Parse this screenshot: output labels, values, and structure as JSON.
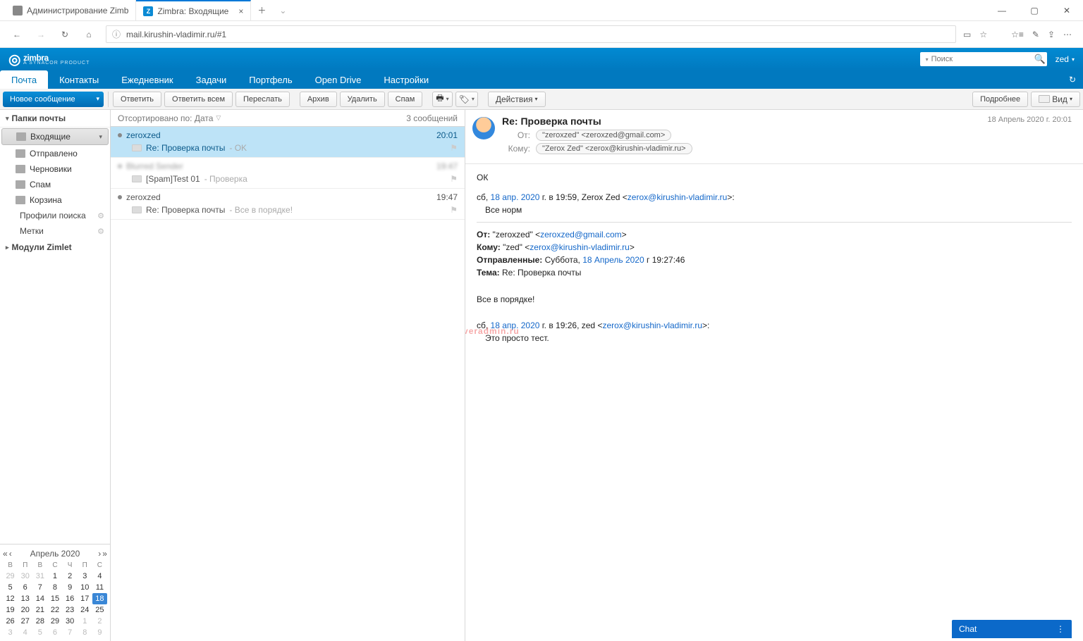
{
  "browser": {
    "tabs": [
      {
        "title": "Администрирование Zimb"
      },
      {
        "title": "Zimbra: Входящие"
      }
    ],
    "url": "mail.kirushin-vladimir.ru/#1"
  },
  "header": {
    "logo": "zimbra",
    "logo_sub": "A SYNACOR PRODUCT",
    "search_placeholder": "Поиск",
    "user": "zed"
  },
  "nav_tabs": [
    "Почта",
    "Контакты",
    "Ежедневник",
    "Задачи",
    "Портфель",
    "Open Drive",
    "Настройки"
  ],
  "toolbar": {
    "compose": "Новое сообщение",
    "reply": "Ответить",
    "reply_all": "Ответить всем",
    "forward": "Переслать",
    "archive": "Архив",
    "delete": "Удалить",
    "spam": "Спам",
    "actions": "Действия",
    "more": "Подробнее",
    "view": "Вид"
  },
  "sidebar": {
    "folders_header": "Папки почты",
    "folders": [
      {
        "label": "Входящие",
        "sel": true,
        "dd": true
      },
      {
        "label": "Отправлено"
      },
      {
        "label": "Черновики"
      },
      {
        "label": "Спам"
      },
      {
        "label": "Корзина"
      }
    ],
    "search_profiles": "Профили поиска",
    "tags": "Метки",
    "zimlets": "Модули Zimlet"
  },
  "list": {
    "sort_label": "Отсортировано по: Дата",
    "count": "3 сообщений",
    "groups": [
      {
        "from": "zeroxzed",
        "time": "20:01",
        "subject": "Re: Проверка почты",
        "preview": "OK",
        "sel": true
      },
      {
        "from": "Blurred Sender",
        "time": "19:47",
        "subject": "[Spam]Test 01",
        "preview": "Проверка",
        "blur": true
      },
      {
        "from": "zeroxzed",
        "time": "19:47",
        "subject": "Re: Проверка почты",
        "preview": "Все в порядке!"
      }
    ]
  },
  "message": {
    "subject": "Re: Проверка почты",
    "date": "18 Апрель 2020 г. 20:01",
    "from_label": "От:",
    "from_value": "\"zeroxzed\" <zeroxzed@gmail.com>",
    "to_label": "Кому:",
    "to_value": "\"Zerox Zed\" <zerox@kirushin-vladimir.ru>",
    "body_ok": "ОК",
    "line1_pre": "сб, ",
    "line1_date": "18 апр. 2020",
    "line1_post": " г. в 19:59, Zerox Zed <",
    "line1_email": "zerox@kirushin-vladimir.ru",
    "line1_end": ">:",
    "line2": "Все норм",
    "q_from_l": "От:",
    "q_from_v": " \"zeroxzed\" <",
    "q_from_e": "zeroxzed@gmail.com",
    "q_from_end": ">",
    "q_to_l": "Кому:",
    "q_to_v": " \"zed\" <",
    "q_to_e": "zerox@kirushin-vladimir.ru",
    "q_to_end": ">",
    "q_sent_l": "Отправленные:",
    "q_sent_v": " Суббота, ",
    "q_sent_d": "18 Апрель 2020",
    "q_sent_t": " г 19:27:46",
    "q_subj_l": "Тема:",
    "q_subj_v": " Re: Проверка почты",
    "q_body": "Все в порядке!",
    "q2_pre": "сб, ",
    "q2_date": "18 апр. 2020",
    "q2_mid": " г. в 19:26, zed <",
    "q2_email": "zerox@kirushin-vladimir.ru",
    "q2_end": ">:",
    "q2_body": "Это просто тест.",
    "watermark": "serveradmin.ru"
  },
  "calendar": {
    "title": "Апрель 2020",
    "dow": [
      "В",
      "П",
      "В",
      "С",
      "Ч",
      "П",
      "С"
    ],
    "weeks": [
      [
        {
          "d": 29,
          "g": true
        },
        {
          "d": 30,
          "g": true
        },
        {
          "d": 31,
          "g": true
        },
        {
          "d": 1
        },
        {
          "d": 2
        },
        {
          "d": 3
        },
        {
          "d": 4
        }
      ],
      [
        {
          "d": 5
        },
        {
          "d": 6
        },
        {
          "d": 7
        },
        {
          "d": 8
        },
        {
          "d": 9
        },
        {
          "d": 10
        },
        {
          "d": 11
        }
      ],
      [
        {
          "d": 12
        },
        {
          "d": 13
        },
        {
          "d": 14
        },
        {
          "d": 15
        },
        {
          "d": 16
        },
        {
          "d": 17
        },
        {
          "d": 18,
          "t": true
        }
      ],
      [
        {
          "d": 19
        },
        {
          "d": 20
        },
        {
          "d": 21
        },
        {
          "d": 22
        },
        {
          "d": 23
        },
        {
          "d": 24
        },
        {
          "d": 25
        }
      ],
      [
        {
          "d": 26
        },
        {
          "d": 27
        },
        {
          "d": 28
        },
        {
          "d": 29
        },
        {
          "d": 30
        },
        {
          "d": 1,
          "g": true
        },
        {
          "d": 2,
          "g": true
        }
      ],
      [
        {
          "d": 3,
          "g": true
        },
        {
          "d": 4,
          "g": true
        },
        {
          "d": 5,
          "g": true
        },
        {
          "d": 6,
          "g": true
        },
        {
          "d": 7,
          "g": true
        },
        {
          "d": 8,
          "g": true
        },
        {
          "d": 9,
          "g": true
        }
      ]
    ]
  },
  "chat": {
    "label": "Chat"
  }
}
